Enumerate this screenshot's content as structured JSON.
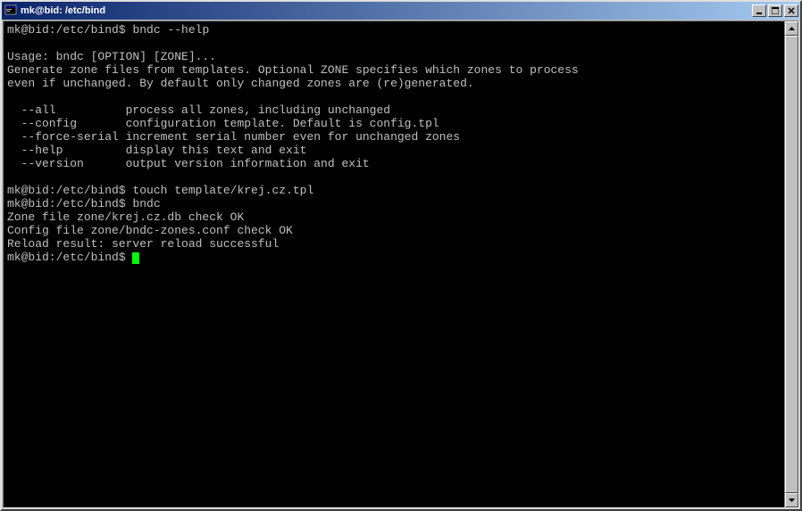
{
  "window": {
    "title": "mk@bid: /etc/bind"
  },
  "terminal": {
    "prompt": "mk@bid:/etc/bind$",
    "lines": {
      "l1_cmd": "bndc --help",
      "l3": "Usage: bndc [OPTION] [ZONE]...",
      "l4": "Generate zone files from templates. Optional ZONE specifies which zones to process",
      "l5": "even if unchanged. By default only changed zones are (re)generated.",
      "l7": "  --all          process all zones, including unchanged",
      "l8": "  --config       configuration template. Default is config.tpl",
      "l9": "  --force-serial increment serial number even for unchanged zones",
      "l10": "  --help         display this text and exit",
      "l11": "  --version      output version information and exit",
      "l13_cmd": "touch template/krej.cz.tpl",
      "l14_cmd": "bndc",
      "l15": "Zone file zone/krej.cz.db check OK",
      "l16": "Config file zone/bndc-zones.conf check OK",
      "l17": "Reload result: server reload successful"
    }
  }
}
